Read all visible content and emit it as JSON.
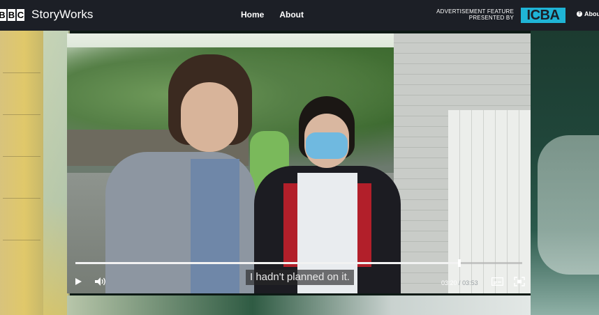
{
  "header": {
    "logo_letters": [
      "B",
      "B",
      "C"
    ],
    "brand": "StoryWorks",
    "nav": [
      "Home",
      "About"
    ],
    "advert_line1": "ADVERTISEMENT FEATURE",
    "advert_line2": "PRESENTED BY",
    "sponsor": "ICBA",
    "about_right": "About"
  },
  "player": {
    "caption": "I hadn't planned on it.",
    "current_time": "03:20",
    "separator": "/",
    "duration": "03:53",
    "progress_fraction": 0.86
  },
  "icons": {
    "play": "play-icon",
    "volume": "volume-icon",
    "captions": "captions-icon",
    "fullscreen": "fullscreen-icon",
    "help": "help-icon"
  },
  "colors": {
    "header_bg": "#1c1f26",
    "sponsor_accent": "#1fb4d6"
  }
}
